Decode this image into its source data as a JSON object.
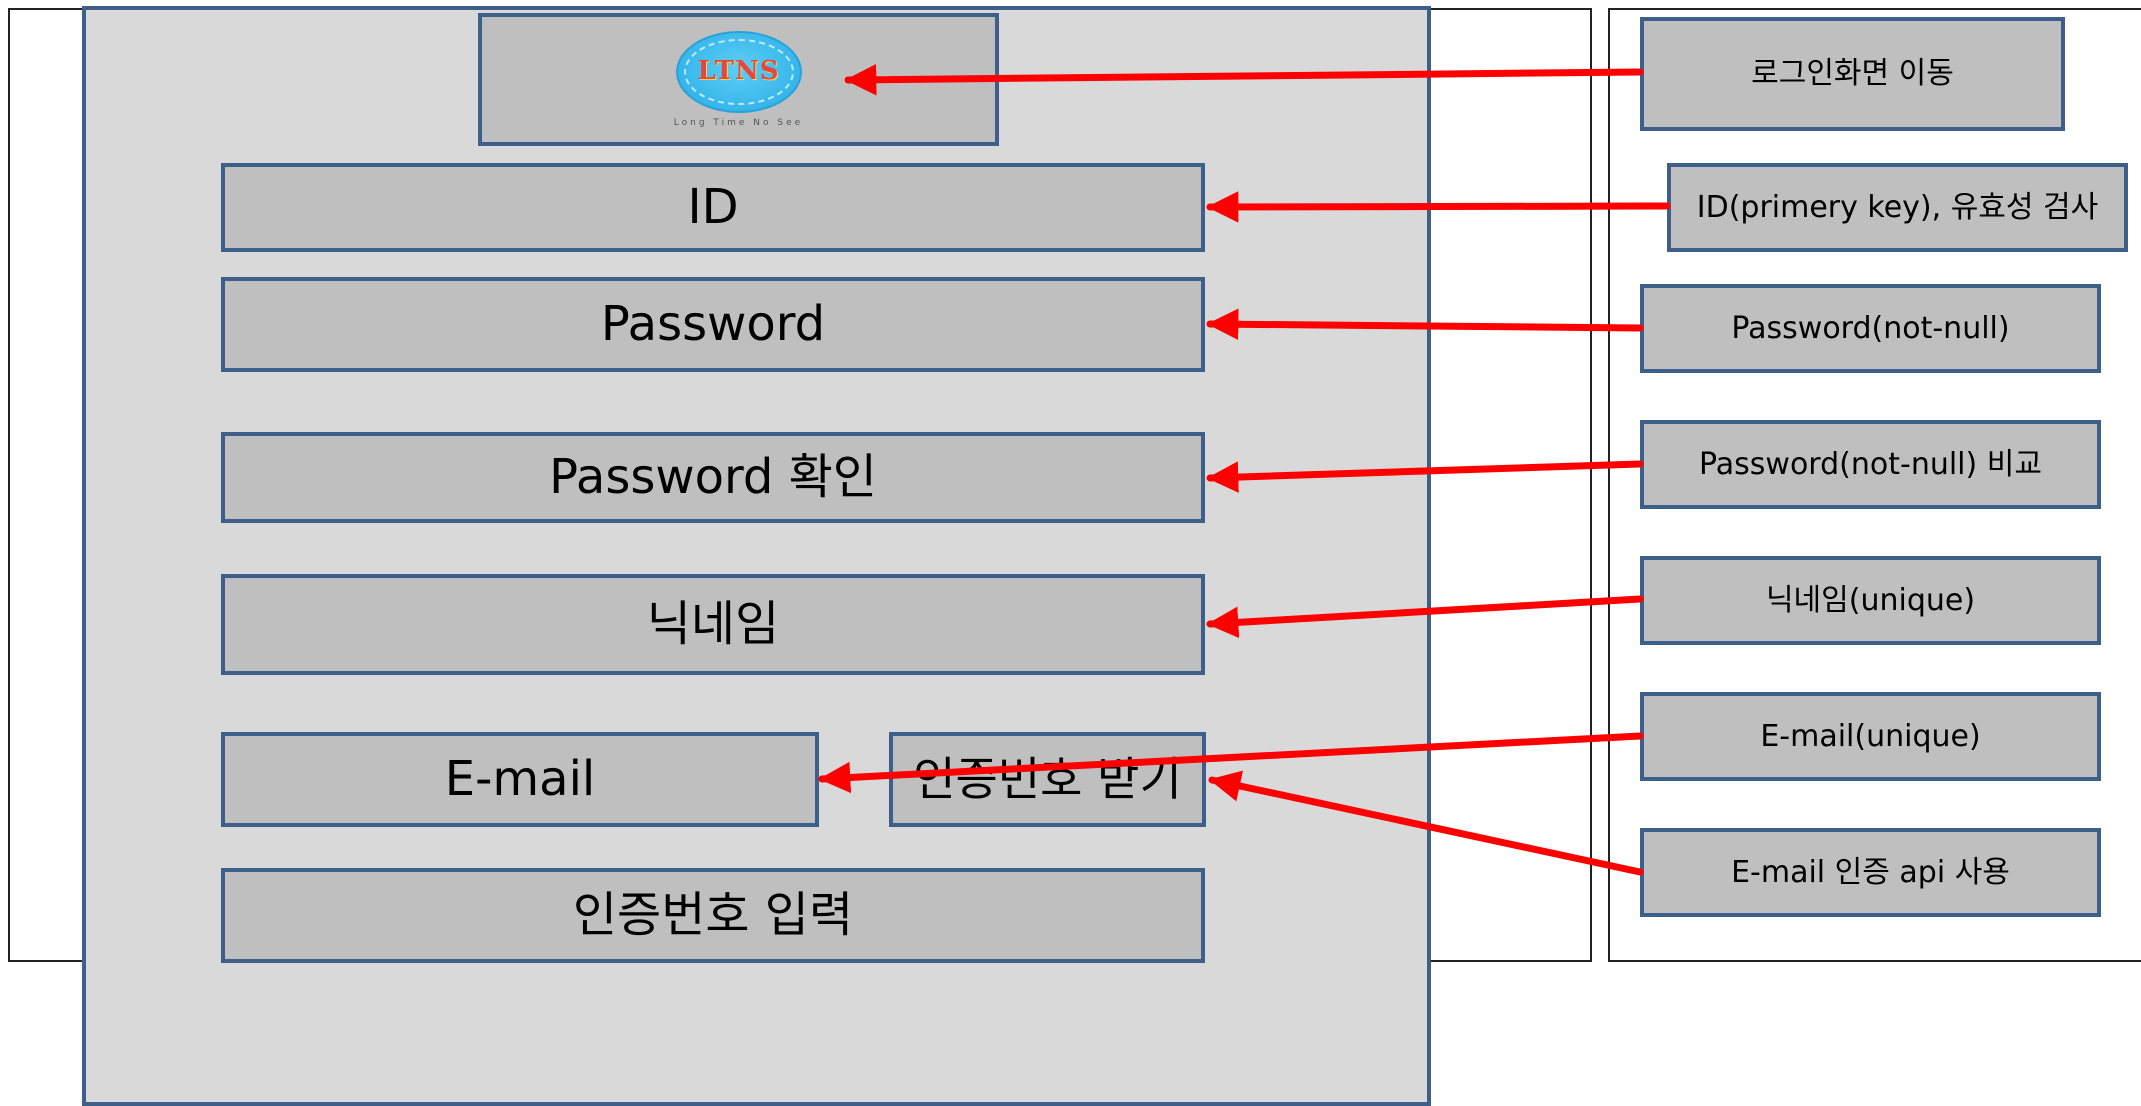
{
  "logo": {
    "mark": "LTNS",
    "subtitle": "Long Time No See",
    "icon": "logo-icon"
  },
  "form": {
    "id_label": "ID",
    "password_label": "Password",
    "password_confirm_label": "Password 확인",
    "nickname_label": "닉네임",
    "email_label": "E-mail",
    "verify_code_request_label": "인증번호 받기",
    "verify_code_input_label": "인증번호 입력"
  },
  "notes": {
    "login_nav": "로그인화면 이동",
    "id_rule": "ID(primery key), 유효성 검사",
    "password_rule": "Password(not-null)",
    "password_confirm_rule": "Password(not-null) 비교",
    "nickname_rule": "닉네임(unique)",
    "email_rule": "E-mail(unique)",
    "email_api_rule": "E-mail 인증 api 사용"
  },
  "colors": {
    "screen_bg": "#d9d9d9",
    "box_fill": "#bfbfbf",
    "box_border": "#3d5f8a",
    "arrow": "#ff0000"
  }
}
